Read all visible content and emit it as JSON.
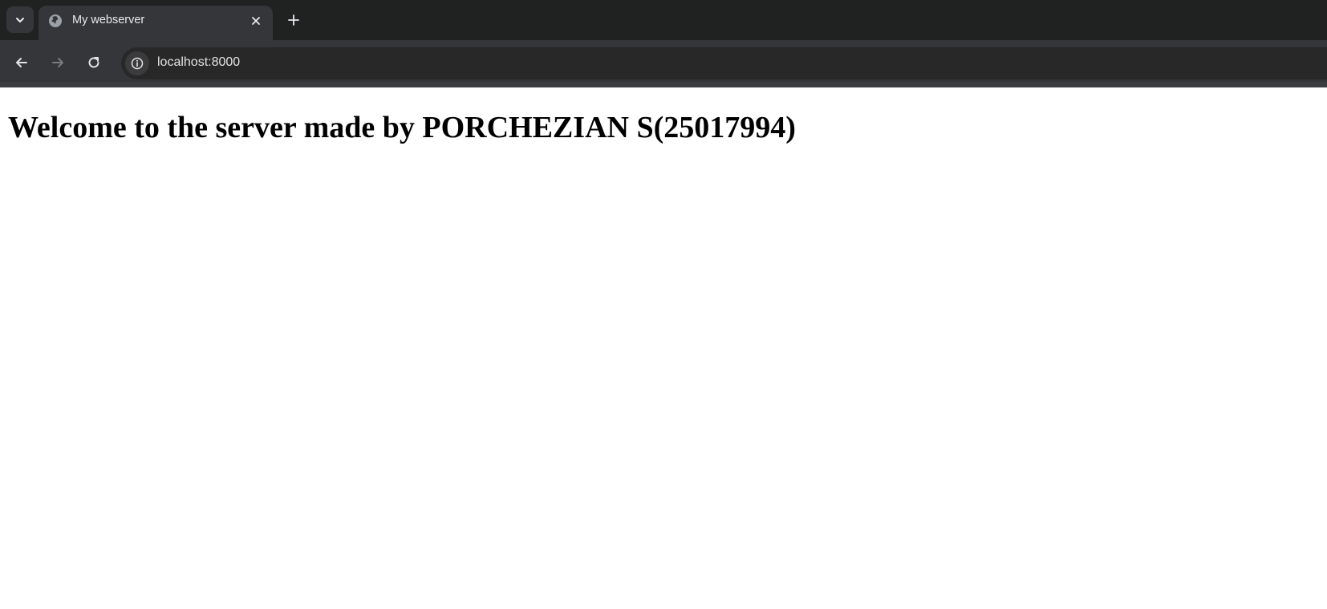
{
  "browser": {
    "tab": {
      "title": "My webserver",
      "favicon": "globe-icon"
    },
    "address_bar": {
      "url": "localhost:8000",
      "site_info_icon": "info-icon"
    },
    "controls": {
      "tab_search_icon": "chevron-down-icon",
      "close_tab_icon": "close-icon",
      "new_tab_icon": "plus-icon",
      "back_icon": "arrow-left-icon",
      "forward_icon": "arrow-right-icon",
      "reload_icon": "reload-icon"
    },
    "colors": {
      "tabstrip": "#202121",
      "toolbar": "#35363a",
      "omnibox": "#282828"
    }
  },
  "page": {
    "heading": "Welcome to the server made by PORCHEZIAN S(25017994)"
  }
}
